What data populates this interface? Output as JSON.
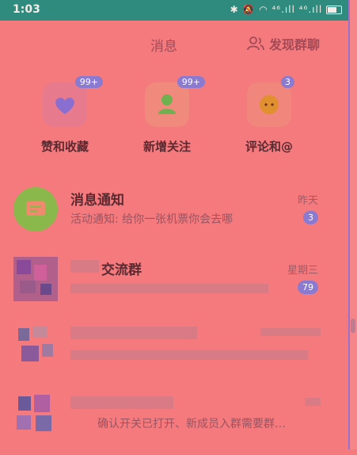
{
  "status_bar": {
    "time": "1:03",
    "icons": "✱ 🔕 ◠ ⁴⁶.ıll ⁴⁶.ıll"
  },
  "header": {
    "title": "消息",
    "discover_label": "发现群聊"
  },
  "quick_actions": [
    {
      "label": "赞和收藏",
      "badge": "99+",
      "icon": "heart-icon",
      "color": "#8a6ed0"
    },
    {
      "label": "新增关注",
      "badge": "99+",
      "icon": "person-icon",
      "color": "#6fb04f"
    },
    {
      "label": "评论和@",
      "badge": "3",
      "icon": "chat-bubble-icon",
      "color": "#e0902e"
    }
  ],
  "messages": [
    {
      "name": "消息通知",
      "preview": "活动通知: 给你一张机票你会去哪",
      "time": "昨天",
      "count": "3"
    },
    {
      "name": "交流群",
      "preview": "",
      "time": "星期三",
      "count": "79"
    },
    {
      "name": "",
      "preview": "",
      "time": "",
      "count": ""
    },
    {
      "name": "",
      "preview": "确认开关已打开、新成员入群需要群…",
      "time": "",
      "count": ""
    }
  ]
}
